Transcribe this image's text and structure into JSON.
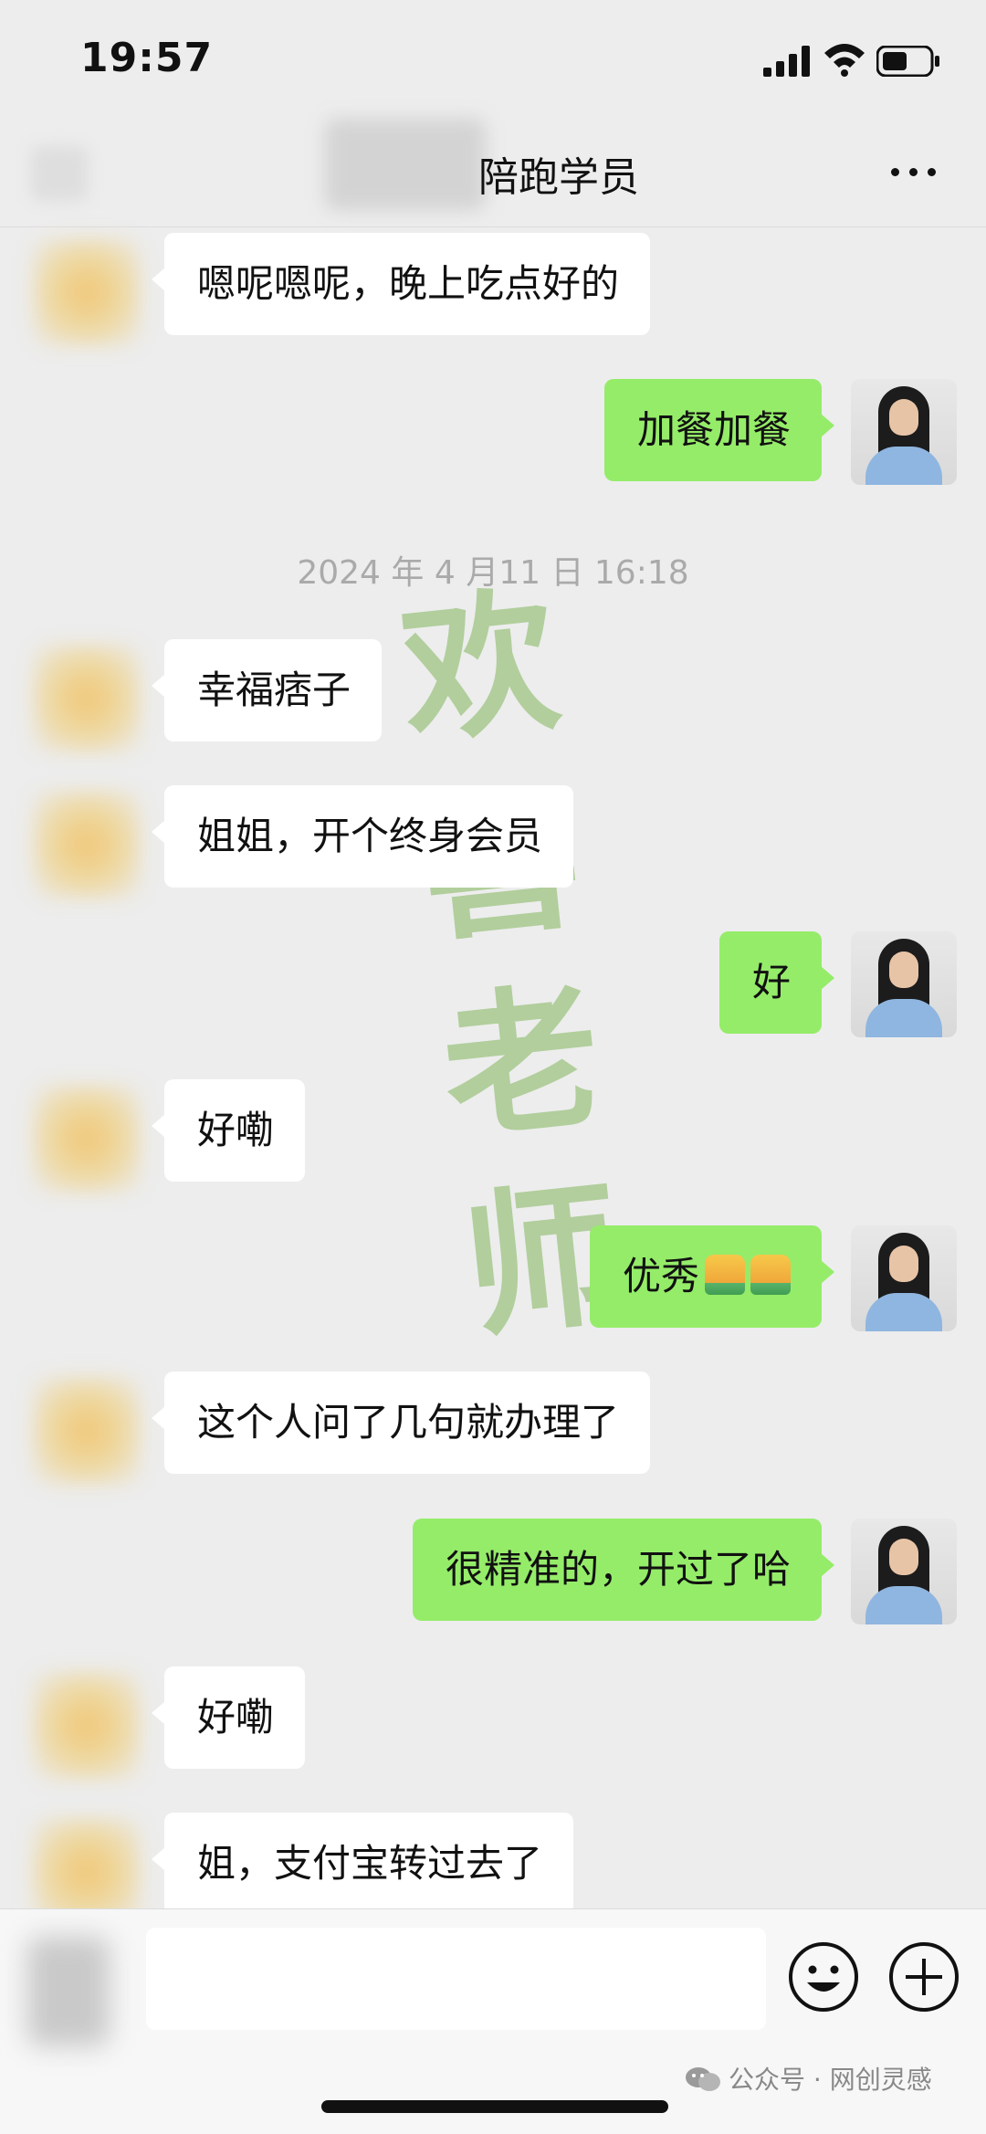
{
  "status_bar": {
    "time": "19:57"
  },
  "header": {
    "title": "陪跑学员"
  },
  "messages": [
    {
      "side": "in",
      "text": "嗯呢嗯呢，晚上吃点好的"
    },
    {
      "side": "out",
      "text": "加餐加餐"
    },
    {
      "side": "in",
      "text": "幸福痞子"
    },
    {
      "side": "in",
      "text": "姐姐，开个终身会员"
    },
    {
      "side": "out",
      "text": "好"
    },
    {
      "side": "in",
      "text": "好嘞"
    },
    {
      "side": "out",
      "text": "优秀"
    },
    {
      "side": "in",
      "text": "这个人问了几句就办理了"
    },
    {
      "side": "out",
      "text": "很精准的，开过了哈"
    },
    {
      "side": "in",
      "text": "好嘞"
    },
    {
      "side": "in",
      "text": "姐，支付宝转过去了"
    }
  ],
  "timestamp": "2024 年 4 月11 日 16:18",
  "watermark": [
    "欢",
    "喜",
    "老",
    "师"
  ],
  "footer": {
    "attribution": "公众号 · 网创灵感"
  },
  "colors": {
    "outgoing_bubble": "#95ec69",
    "incoming_bubble": "#ffffff",
    "background": "#ededed"
  },
  "icons": [
    "signal-icon",
    "wifi-icon",
    "battery-icon",
    "more-icon",
    "emoji-icon",
    "plus-icon",
    "thumbs-up-icon",
    "wechat-icon"
  ]
}
